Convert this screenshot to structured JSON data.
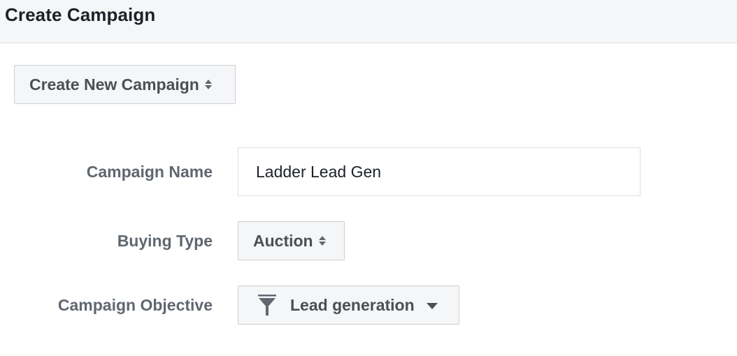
{
  "header": {
    "title": "Create Campaign"
  },
  "campaign_mode": {
    "selected": "Create New Campaign"
  },
  "form": {
    "campaign_name": {
      "label": "Campaign Name",
      "value": "Ladder Lead Gen"
    },
    "buying_type": {
      "label": "Buying Type",
      "selected": "Auction"
    },
    "campaign_objective": {
      "label": "Campaign Objective",
      "selected": "Lead generation",
      "icon": "funnel-icon"
    }
  },
  "colors": {
    "header_bg": "#f5f6f7",
    "button_bg": "#f5f6f7",
    "button_text": "#4b4f56",
    "label_text": "#606770",
    "border": "#ced0d4"
  }
}
